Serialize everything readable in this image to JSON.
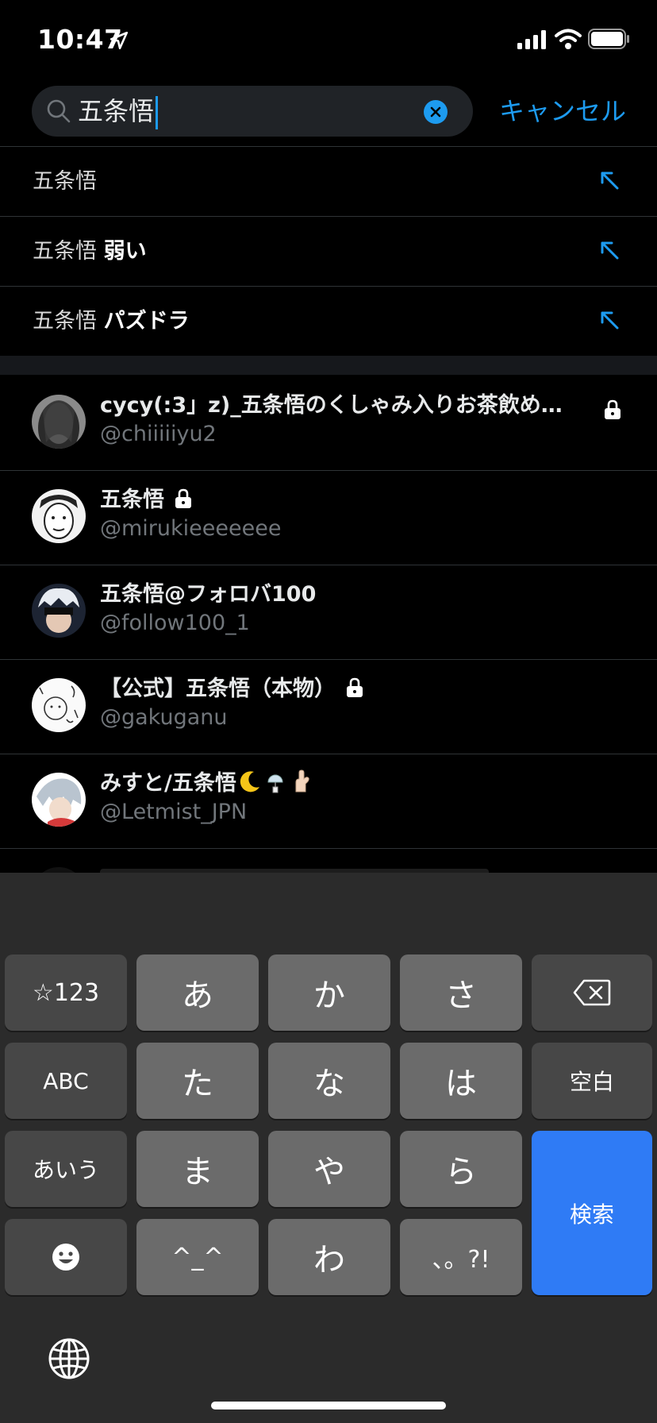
{
  "status_bar": {
    "time": "10:47"
  },
  "search": {
    "query": "五条悟",
    "cancel_label": "キャンセル"
  },
  "suggestions": [
    {
      "prefix": "五条悟",
      "suffix": ""
    },
    {
      "prefix": "五条悟",
      "suffix": "弱い"
    },
    {
      "prefix": "五条悟",
      "suffix": "パズドラ"
    }
  ],
  "users": [
    {
      "name": "cycy(:3」z)_五条悟のくしゃみ入りお茶飲め…",
      "handle": "@chiiiiiyu2",
      "locked": true
    },
    {
      "name": "五条悟",
      "handle": "@mirukieeeeeee",
      "locked": true
    },
    {
      "name": "五条悟@フォロバ100",
      "handle": "@follow100_1",
      "locked": false
    },
    {
      "name": "【公式】五条悟（本物）",
      "handle": "@gakuganu",
      "locked": true
    },
    {
      "name": "みすと/五条悟",
      "handle": "@Letmist_JPN",
      "locked": false
    }
  ],
  "keyboard": {
    "row1": [
      "☆123",
      "あ",
      "か",
      "さ"
    ],
    "row2": [
      "ABC",
      "た",
      "な",
      "は",
      "空白"
    ],
    "row3": [
      "あいう",
      "ま",
      "や",
      "ら"
    ],
    "row4": [
      "^_^",
      "わ",
      "、。?!"
    ],
    "search_label": "検索"
  },
  "colors": {
    "accent": "#1d9bf0",
    "search_key": "#2f7bf5",
    "background": "#000000"
  }
}
